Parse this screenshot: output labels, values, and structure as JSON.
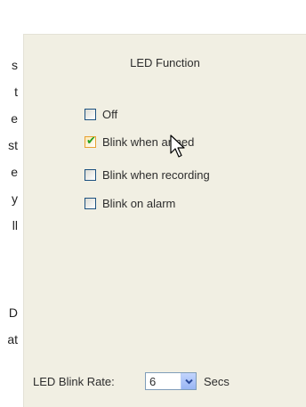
{
  "left_fragments": [
    "s",
    "t",
    "e",
    "st",
    "e",
    "y",
    "ll",
    "D",
    "at"
  ],
  "panel": {
    "title": "LED Function",
    "options": [
      {
        "label": "Off",
        "checked": false
      },
      {
        "label": "Blink when armed",
        "checked": true
      },
      {
        "label": "Blink when recording",
        "checked": false
      },
      {
        "label": "Blink on alarm",
        "checked": false
      }
    ]
  },
  "blink_rate": {
    "label": "LED Blink Rate:",
    "value": "6",
    "unit": "Secs"
  },
  "colors": {
    "panel_bg": "#f1efe3",
    "check_green": "#21a121",
    "checkbox_border": "#1c5180"
  },
  "icons": {
    "checkmark": "checkmark-icon",
    "dropdown": "chevron-down-icon",
    "cursor": "mouse-cursor-icon"
  }
}
